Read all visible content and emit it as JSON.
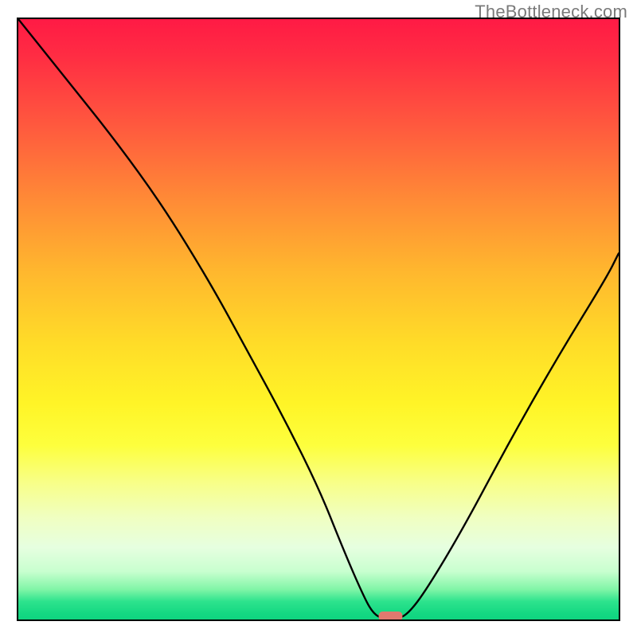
{
  "watermark": "TheBottleneck.com",
  "chart_data": {
    "type": "line",
    "title": "",
    "xlabel": "",
    "ylabel": "",
    "xlim": [
      0,
      100
    ],
    "ylim": [
      0,
      100
    ],
    "grid": false,
    "background": "rainbow-gradient (red top → green bottom)",
    "series": [
      {
        "name": "bottleneck-curve",
        "x": [
          0,
          8,
          16,
          24,
          32,
          38,
          44,
          50,
          54,
          57,
          59,
          61,
          63,
          65,
          68,
          74,
          82,
          90,
          98,
          100
        ],
        "values": [
          100,
          90,
          80,
          69,
          56,
          45,
          34,
          22,
          12,
          5,
          1,
          0,
          0,
          1,
          5,
          15,
          30,
          44,
          57,
          61
        ]
      }
    ],
    "marker": {
      "name": "optimal-point",
      "x": 62,
      "y": 0,
      "shape": "rounded-rect",
      "color": "#e0796f"
    }
  }
}
